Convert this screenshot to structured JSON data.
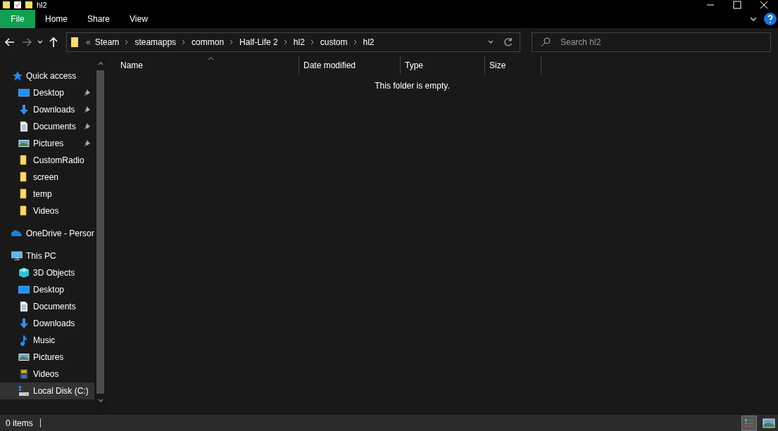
{
  "window": {
    "title": "hl2"
  },
  "ribbon": {
    "tabs": [
      {
        "label": "File",
        "kind": "file",
        "selected": false
      },
      {
        "label": "Home",
        "kind": "tab",
        "selected": false
      },
      {
        "label": "Share",
        "kind": "tab",
        "selected": false
      },
      {
        "label": "View",
        "kind": "tab",
        "selected": false
      }
    ]
  },
  "navigation": {
    "back_enabled": true,
    "forward_enabled": false
  },
  "address_bar": {
    "overflow": "«",
    "path": [
      "Steam",
      "steamapps",
      "common",
      "Half-Life 2",
      "hl2",
      "custom",
      "hl2"
    ]
  },
  "search": {
    "placeholder": "Search hl2"
  },
  "sidebar": {
    "items": [
      {
        "label": "Quick access",
        "kind": "star",
        "selected": false,
        "children": [
          {
            "label": "Desktop",
            "kind": "desktop",
            "pinned": true,
            "selected": false
          },
          {
            "label": "Downloads",
            "kind": "download",
            "pinned": true,
            "selected": false
          },
          {
            "label": "Documents",
            "kind": "document",
            "pinned": true,
            "selected": false
          },
          {
            "label": "Pictures",
            "kind": "pictures",
            "pinned": true,
            "selected": false
          },
          {
            "label": "CustomRadio",
            "kind": "folder",
            "pinned": false,
            "selected": false
          },
          {
            "label": "screen",
            "kind": "folder",
            "pinned": false,
            "selected": false
          },
          {
            "label": "temp",
            "kind": "folder",
            "pinned": false,
            "selected": false
          },
          {
            "label": "Videos",
            "kind": "folder",
            "pinned": false,
            "selected": false
          }
        ]
      },
      {
        "label": "OneDrive - Persor",
        "kind": "cloud",
        "selected": false
      },
      {
        "label": "This PC",
        "kind": "pc",
        "selected": false,
        "children": [
          {
            "label": "3D Objects",
            "kind": "cube",
            "selected": false
          },
          {
            "label": "Desktop",
            "kind": "desktop",
            "selected": false
          },
          {
            "label": "Documents",
            "kind": "document",
            "selected": false
          },
          {
            "label": "Downloads",
            "kind": "download",
            "selected": false
          },
          {
            "label": "Music",
            "kind": "music",
            "selected": false
          },
          {
            "label": "Pictures",
            "kind": "pictures",
            "selected": false
          },
          {
            "label": "Videos",
            "kind": "videos",
            "selected": false
          },
          {
            "label": "Local Disk (C:)",
            "kind": "disk",
            "selected": true
          }
        ]
      }
    ]
  },
  "table": {
    "columns": [
      {
        "label": "Name",
        "sorted": true
      },
      {
        "label": "Date modified",
        "sorted": false
      },
      {
        "label": "Type",
        "sorted": false
      },
      {
        "label": "Size",
        "sorted": false
      }
    ],
    "empty_message": "This folder is empty."
  },
  "status_bar": {
    "item_count": "0 items",
    "views": [
      {
        "kind": "details",
        "selected": true
      },
      {
        "kind": "icons",
        "selected": false
      }
    ]
  }
}
